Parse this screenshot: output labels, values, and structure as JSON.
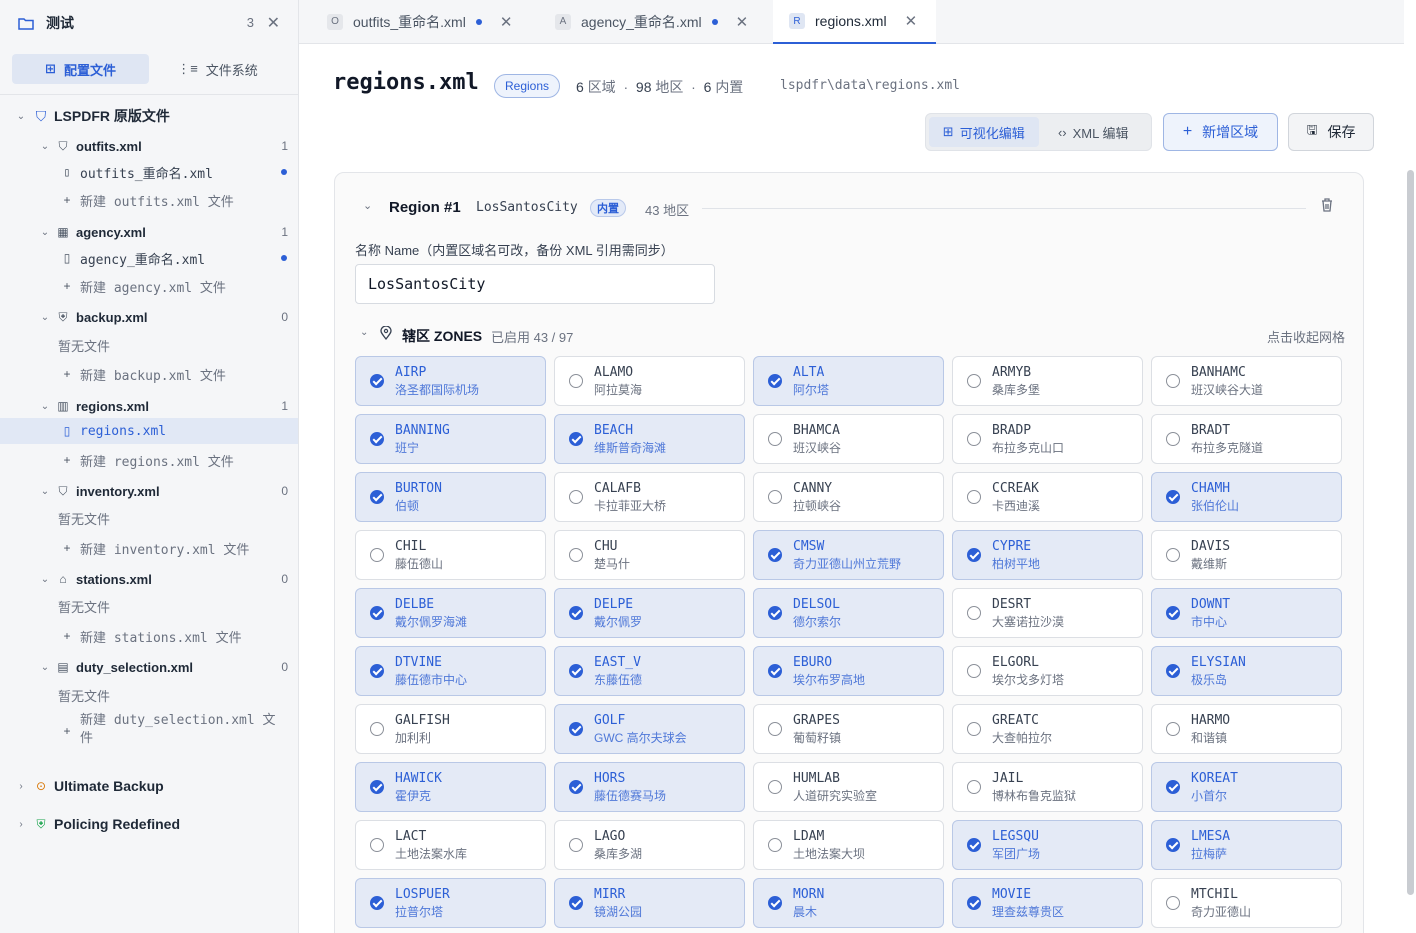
{
  "workspace": {
    "title": "测试",
    "count": "3",
    "close": "✕"
  },
  "sidebar": {
    "switch": {
      "config": "配置文件",
      "fs": "文件系统"
    },
    "root": {
      "label": "LSPDFR 原版文件"
    },
    "groups": [
      {
        "label": "outfits.xml",
        "count": "1",
        "files": [
          "outfits_重命名.xml"
        ],
        "new": "新建 outfits.xml 文件"
      },
      {
        "label": "agency.xml",
        "count": "1",
        "files": [
          "agency_重命名.xml"
        ],
        "new": "新建 agency.xml 文件"
      },
      {
        "label": "backup.xml",
        "count": "0",
        "empty": "暂无文件",
        "new": "新建 backup.xml 文件"
      },
      {
        "label": "regions.xml",
        "count": "1",
        "files": [
          "regions.xml"
        ],
        "new": "新建 regions.xml 文件"
      },
      {
        "label": "inventory.xml",
        "count": "0",
        "empty": "暂无文件",
        "new": "新建 inventory.xml 文件"
      },
      {
        "label": "stations.xml",
        "count": "0",
        "empty": "暂无文件",
        "new": "新建 stations.xml 文件"
      },
      {
        "label": "duty_selection.xml",
        "count": "0",
        "empty": "暂无文件",
        "new_line1": "新建 duty_selection.xml 文",
        "new_line2": "件"
      }
    ],
    "others": [
      {
        "label": "Ultimate Backup"
      },
      {
        "label": "Policing Redefined"
      }
    ]
  },
  "tabs": [
    {
      "badge": "O",
      "label": "outfits_重命名.xml"
    },
    {
      "badge": "A",
      "label": "agency_重命名.xml"
    },
    {
      "badge": "R",
      "label": "regions.xml"
    }
  ],
  "header": {
    "title": "regions.xml",
    "pill": "Regions",
    "stats": {
      "regions_n": "6",
      "regions_u": "区域",
      "sep": "·",
      "areas_n": "98",
      "areas_u": "地区",
      "builtin_n": "6",
      "builtin_u": "内置"
    },
    "path": "lspdfr\\data\\regions.xml"
  },
  "toolbar": {
    "visual": "可视化编辑",
    "xml": "XML 编辑",
    "add": "新增区域",
    "save": "保存"
  },
  "region": {
    "title": "Region #1",
    "name": "LosSantosCity",
    "tag": "内置",
    "count": "43 地区",
    "name_label": "名称 Name（内置区域名可改，备份 XML 引用需同步）",
    "name_value": "LosSantosCity"
  },
  "zones_head": {
    "title": "辖区 ZONES",
    "count": "已启用 43 / 97",
    "collapse": "点击收起网格"
  },
  "zones": [
    {
      "code": "AIRP",
      "name": "洛圣都国际机场",
      "on": true
    },
    {
      "code": "ALAMO",
      "name": "阿拉莫海",
      "on": false
    },
    {
      "code": "ALTA",
      "name": "阿尔塔",
      "on": true
    },
    {
      "code": "ARMYB",
      "name": "桑库多堡",
      "on": false
    },
    {
      "code": "BANHAMC",
      "name": "班汉峡谷大道",
      "on": false
    },
    {
      "code": "BANNING",
      "name": "班宁",
      "on": true
    },
    {
      "code": "BEACH",
      "name": "维斯普奇海滩",
      "on": true
    },
    {
      "code": "BHAMCA",
      "name": "班汉峡谷",
      "on": false
    },
    {
      "code": "BRADP",
      "name": "布拉多克山口",
      "on": false
    },
    {
      "code": "BRADT",
      "name": "布拉多克隧道",
      "on": false
    },
    {
      "code": "BURTON",
      "name": "伯顿",
      "on": true
    },
    {
      "code": "CALAFB",
      "name": "卡拉菲亚大桥",
      "on": false
    },
    {
      "code": "CANNY",
      "name": "拉顿峡谷",
      "on": false
    },
    {
      "code": "CCREAK",
      "name": "卡西迪溪",
      "on": false
    },
    {
      "code": "CHAMH",
      "name": "张伯伦山",
      "on": true
    },
    {
      "code": "CHIL",
      "name": "藤伍德山",
      "on": false
    },
    {
      "code": "CHU",
      "name": "楚马什",
      "on": false
    },
    {
      "code": "CMSW",
      "name": "奇力亚德山州立荒野",
      "on": true
    },
    {
      "code": "CYPRE",
      "name": "柏树平地",
      "on": true
    },
    {
      "code": "DAVIS",
      "name": "戴维斯",
      "on": false
    },
    {
      "code": "DELBE",
      "name": "戴尔佩罗海滩",
      "on": true
    },
    {
      "code": "DELPE",
      "name": "戴尔佩罗",
      "on": true
    },
    {
      "code": "DELSOL",
      "name": "德尔索尔",
      "on": true
    },
    {
      "code": "DESRT",
      "name": "大塞诺拉沙漠",
      "on": false
    },
    {
      "code": "DOWNT",
      "name": "市中心",
      "on": true
    },
    {
      "code": "DTVINE",
      "name": "藤伍德市中心",
      "on": true
    },
    {
      "code": "EAST_V",
      "name": "东藤伍德",
      "on": true
    },
    {
      "code": "EBURO",
      "name": "埃尔布罗高地",
      "on": true
    },
    {
      "code": "ELGORL",
      "name": "埃尔戈多灯塔",
      "on": false
    },
    {
      "code": "ELYSIAN",
      "name": "极乐岛",
      "on": true
    },
    {
      "code": "GALFISH",
      "name": "加利利",
      "on": false
    },
    {
      "code": "GOLF",
      "name": "GWC 高尔夫球会",
      "on": true
    },
    {
      "code": "GRAPES",
      "name": "葡萄籽镇",
      "on": false
    },
    {
      "code": "GREATC",
      "name": "大查帕拉尔",
      "on": false
    },
    {
      "code": "HARMO",
      "name": "和谐镇",
      "on": false
    },
    {
      "code": "HAWICK",
      "name": "霍伊克",
      "on": true
    },
    {
      "code": "HORS",
      "name": "藤伍德赛马场",
      "on": true
    },
    {
      "code": "HUMLAB",
      "name": "人道研究实验室",
      "on": false
    },
    {
      "code": "JAIL",
      "name": "博林布鲁克监狱",
      "on": false
    },
    {
      "code": "KOREAT",
      "name": "小首尔",
      "on": true
    },
    {
      "code": "LACT",
      "name": "土地法案水库",
      "on": false
    },
    {
      "code": "LAGO",
      "name": "桑库多湖",
      "on": false
    },
    {
      "code": "LDAM",
      "name": "土地法案大坝",
      "on": false
    },
    {
      "code": "LEGSQU",
      "name": "军团广场",
      "on": true
    },
    {
      "code": "LMESA",
      "name": "拉梅萨",
      "on": true
    },
    {
      "code": "LOSPUER",
      "name": "拉普尔塔",
      "on": true
    },
    {
      "code": "MIRR",
      "name": "镜湖公园",
      "on": true
    },
    {
      "code": "MORN",
      "name": "晨木",
      "on": true
    },
    {
      "code": "MOVIE",
      "name": "理查兹尊贵区",
      "on": true
    },
    {
      "code": "MTCHIL",
      "name": "奇力亚德山",
      "on": false
    }
  ]
}
